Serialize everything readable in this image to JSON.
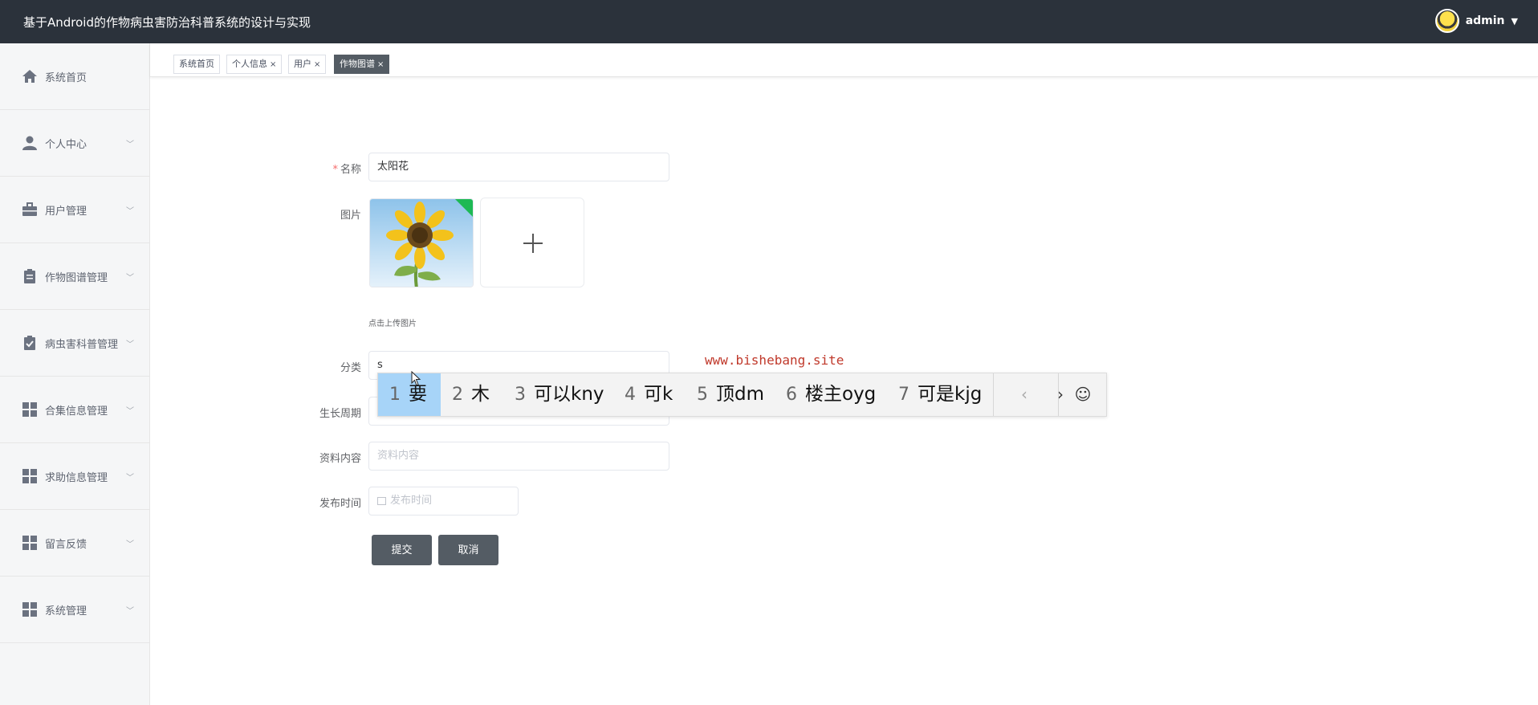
{
  "header": {
    "app_title": "基于Android的作物病虫害防治科普系统的设计与实现",
    "username": "admin",
    "caret": "▼"
  },
  "sidebar": {
    "items": [
      {
        "label": "系统首页",
        "icon": "home-icon",
        "chevron": ""
      },
      {
        "label": "个人中心",
        "icon": "user-icon",
        "chevron": "﹀"
      },
      {
        "label": "用户管理",
        "icon": "briefcase-icon",
        "chevron": "﹀"
      },
      {
        "label": "作物图谱管理",
        "icon": "clipboard-icon",
        "chevron": "﹀"
      },
      {
        "label": "病虫害科普管理",
        "icon": "clipboard-check-icon",
        "chevron": "﹀"
      },
      {
        "label": "合集信息管理",
        "icon": "grid-icon",
        "chevron": "﹀"
      },
      {
        "label": "求助信息管理",
        "icon": "grid-icon",
        "chevron": "﹀"
      },
      {
        "label": "留言反馈",
        "icon": "grid-icon",
        "chevron": "﹀"
      },
      {
        "label": "系统管理",
        "icon": "grid-icon",
        "chevron": "﹀"
      }
    ]
  },
  "tabs": [
    {
      "label": "系统首页",
      "close": ""
    },
    {
      "label": "个人信息",
      "close": "×"
    },
    {
      "label": "用户",
      "close": "×"
    },
    {
      "label": "作物图谱",
      "close": "×",
      "active": true
    }
  ],
  "form": {
    "name_label": "名称",
    "required_mark": "*",
    "name_value": "太阳花",
    "image_label": "图片",
    "upload_tip": "点击上传图片",
    "category_label": "分类",
    "category_value": "s",
    "growth_label": "生长周期",
    "content_label": "资料内容",
    "content_placeholder": "资料内容",
    "date_label": "发布时间",
    "date_placeholder": "发布时间",
    "submit_label": "提交",
    "cancel_label": "取消"
  },
  "watermark": "www.bishebang.site",
  "ime": {
    "candidates": [
      {
        "num": "1",
        "text": "要"
      },
      {
        "num": "2",
        "text": "木"
      },
      {
        "num": "3",
        "text": "可以kny"
      },
      {
        "num": "4",
        "text": "可k"
      },
      {
        "num": "5",
        "text": "顶dm"
      },
      {
        "num": "6",
        "text": "楼主oyg"
      },
      {
        "num": "7",
        "text": "可是kjg"
      }
    ],
    "prev": "‹",
    "next": "›",
    "emoji": "☺"
  },
  "colors": {
    "header_bg": "#2b323b",
    "sidebar_bg": "#f5f6f7",
    "button_bg": "#545c64",
    "required": "#f56c6c",
    "watermark": "#c0392b",
    "ime_selected": "#a7d4f8"
  }
}
